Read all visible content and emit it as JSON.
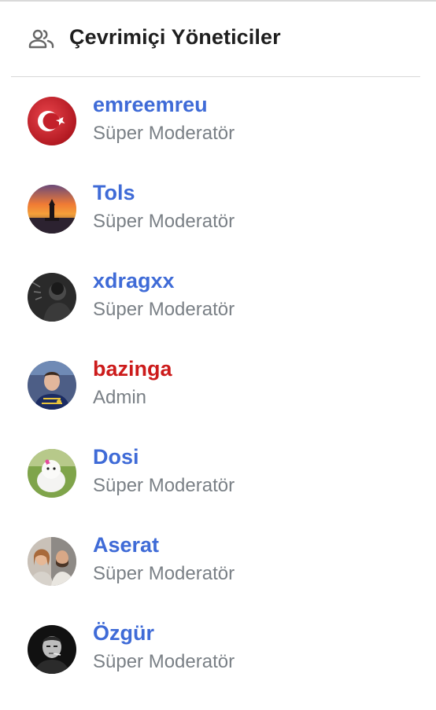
{
  "header": {
    "title": "Çevrimiçi Yöneticiler",
    "icon": "people-icon"
  },
  "colors": {
    "moderator_name": "#3f6bd7",
    "admin_name": "#cc1b1b",
    "role_text": "#7a8086"
  },
  "moderators": [
    {
      "name": "emreemreu",
      "role": "Süper Moderatör",
      "avatar": "turkish-flag-avatar"
    },
    {
      "name": "Tols",
      "role": "Süper Moderatör",
      "avatar": "sunset-tower-avatar"
    },
    {
      "name": "xdragxx",
      "role": "Süper Moderatör",
      "avatar": "dark-portrait-avatar"
    },
    {
      "name": "bazinga",
      "role": "Admin",
      "avatar": "jersey-portrait-avatar"
    },
    {
      "name": "Dosi",
      "role": "Süper Moderatör",
      "avatar": "white-kitten-avatar"
    },
    {
      "name": "Aserat",
      "role": "Süper Moderatör",
      "avatar": "couple-photo-avatar"
    },
    {
      "name": "Özgür",
      "role": "Süper Moderatör",
      "avatar": "bw-portrait-avatar"
    }
  ]
}
